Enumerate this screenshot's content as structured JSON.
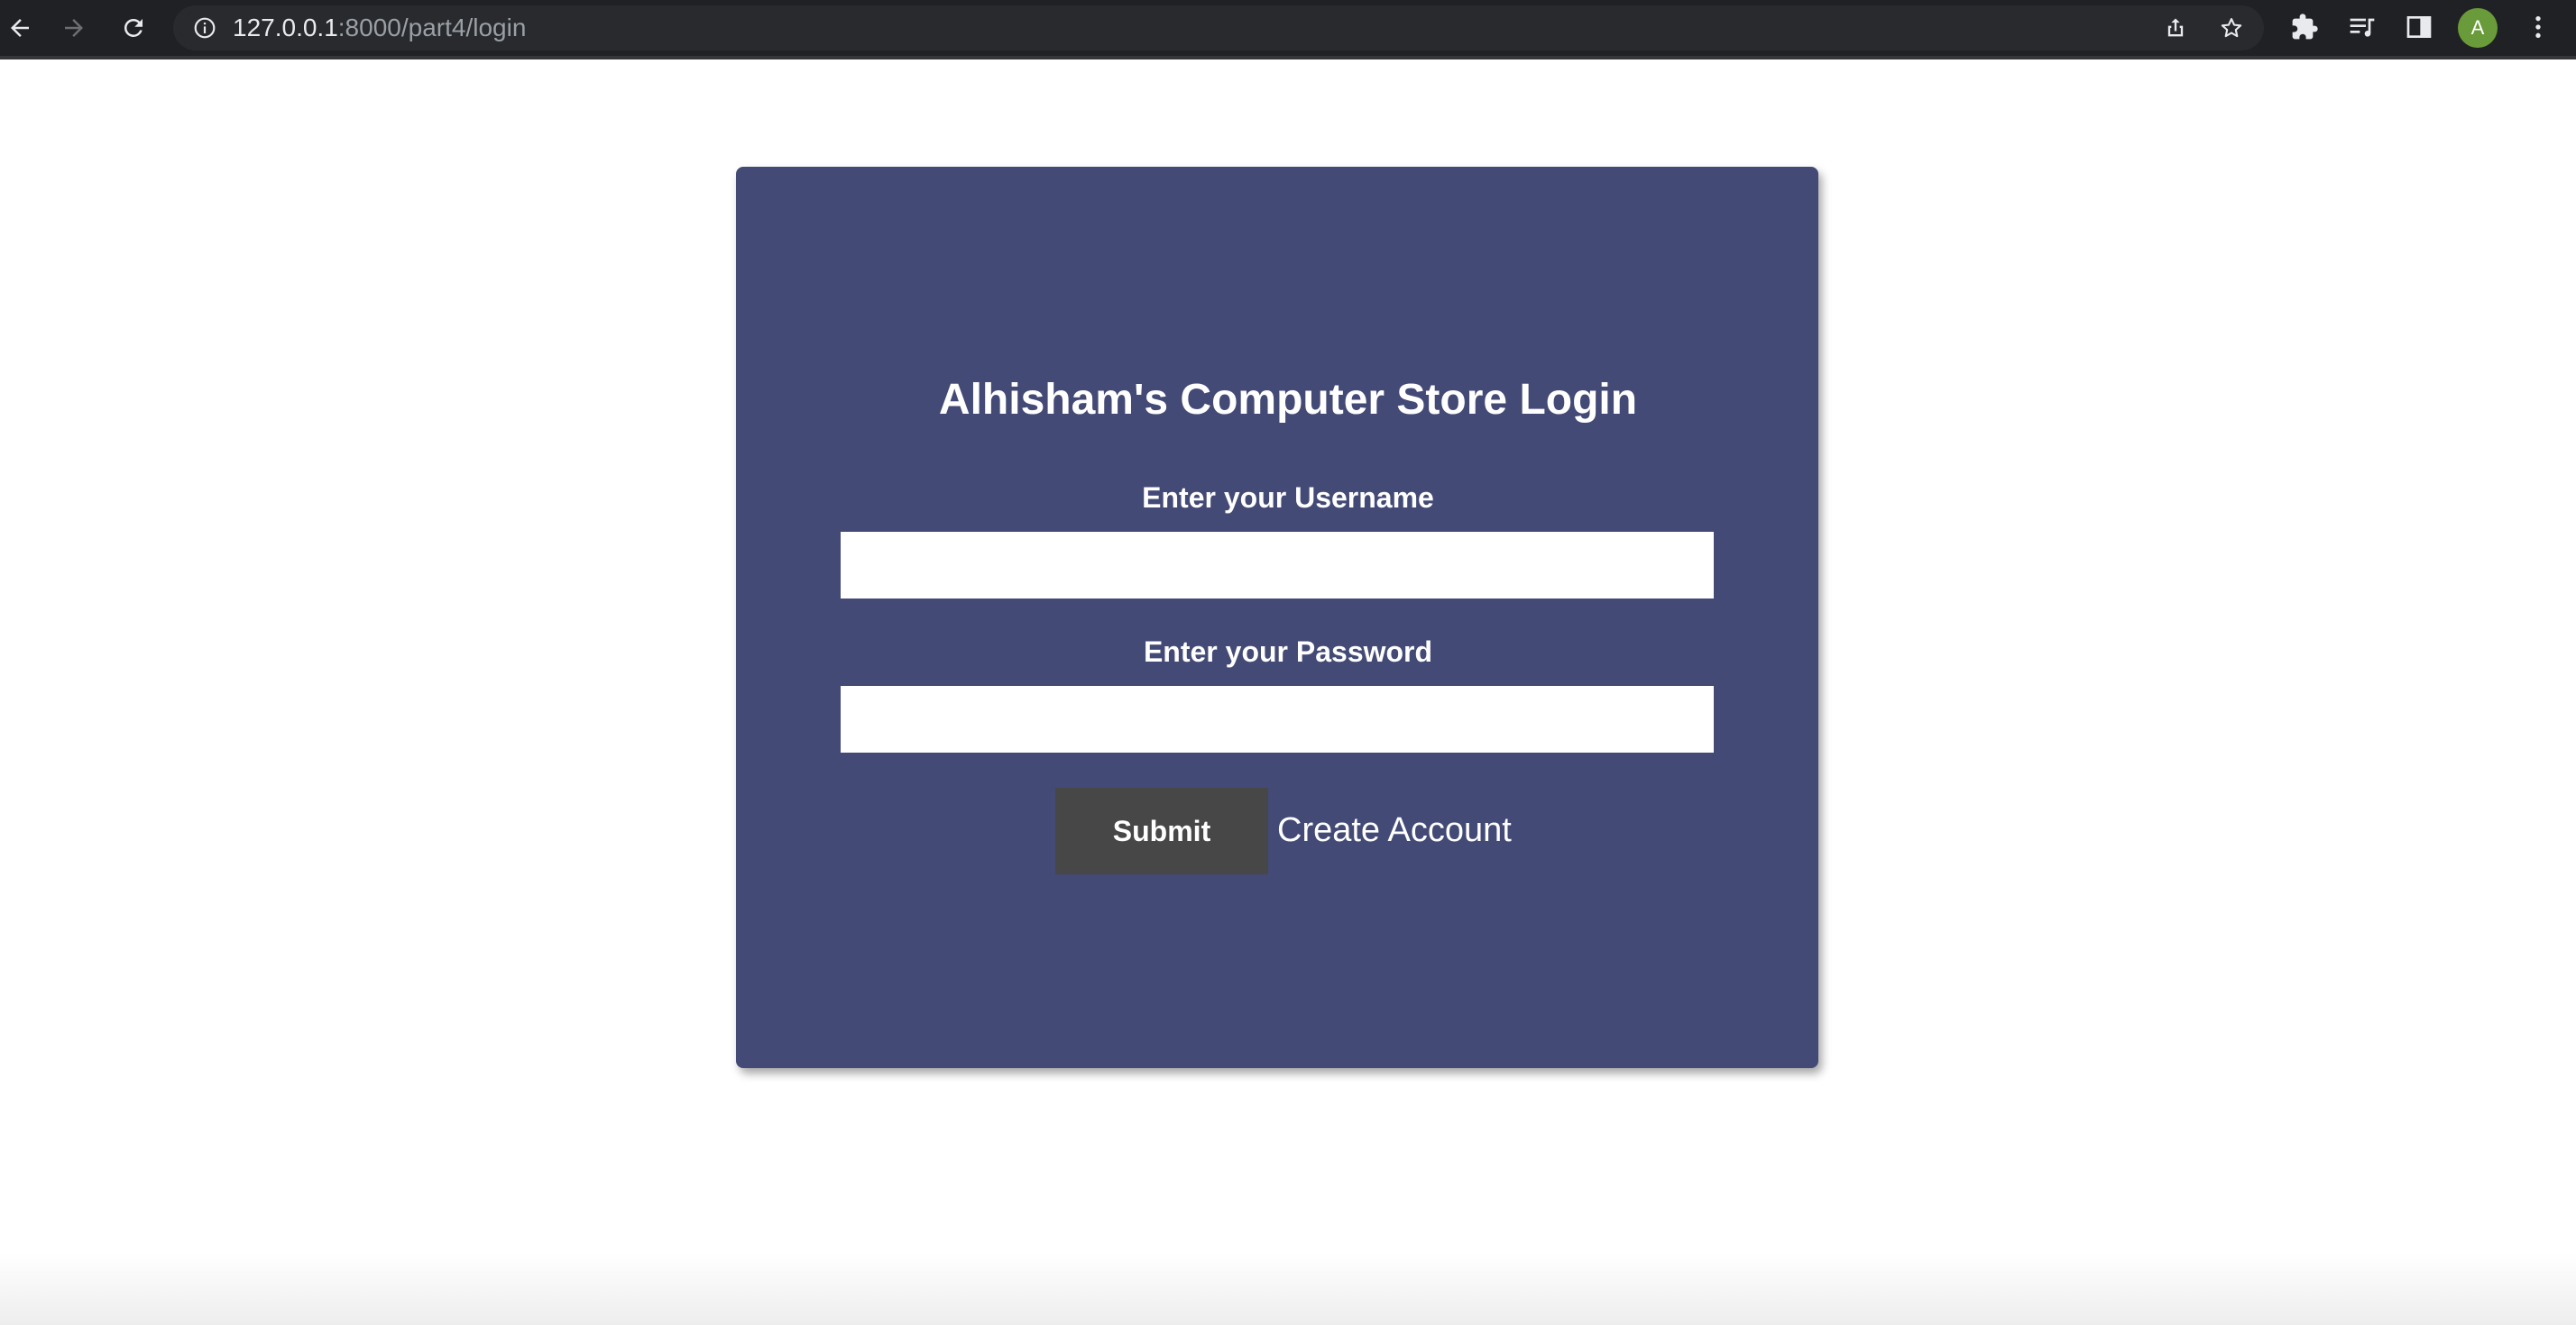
{
  "browser": {
    "url_host": "127.0.0.1",
    "url_rest": ":8000/part4/login",
    "profile_initial": "A",
    "icons": {
      "back": "arrow-left-icon",
      "forward": "arrow-right-icon",
      "reload": "reload-icon",
      "site_info": "info-icon",
      "share": "share-icon",
      "bookmark": "star-icon",
      "extensions": "puzzle-icon",
      "media": "playlist-icon",
      "side_panel": "side-panel-icon",
      "menu": "kebab-menu-icon"
    }
  },
  "login": {
    "title": "Alhisham's Computer Store Login",
    "username_label": "Enter your Username",
    "username_value": "",
    "password_label": "Enter your Password",
    "password_value": "",
    "submit_label": "Submit",
    "create_account_label": "Create Account"
  },
  "colors": {
    "card_background": "#434a76",
    "submit_background": "#474747",
    "page_background": "#ffffff",
    "chrome_background": "#202124"
  }
}
